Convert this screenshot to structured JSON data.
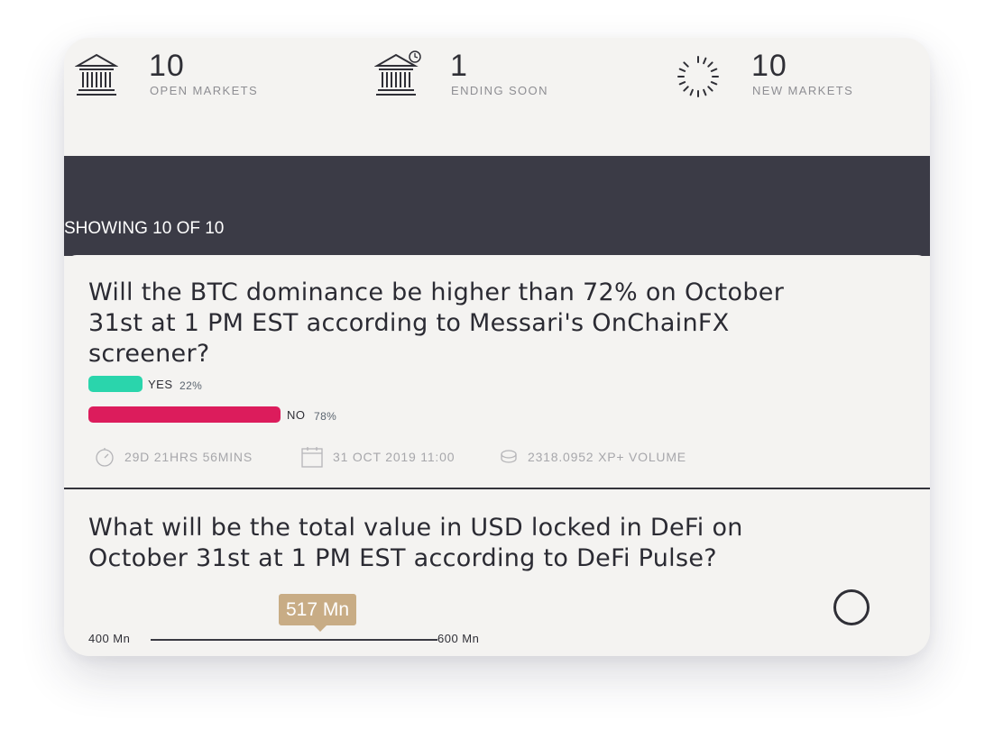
{
  "stats": [
    {
      "icon": "bank-icon",
      "value": "10",
      "label": "OPEN MARKETS"
    },
    {
      "icon": "bank-clock-icon",
      "value": "1",
      "label": "ENDING SOON"
    },
    {
      "icon": "spinner-icon",
      "value": "10",
      "label": "NEW MARKETS"
    }
  ],
  "showing": "SHOWING 10 OF 10",
  "markets": [
    {
      "title_lines": [
        "Will the BTC dominance be higher than 72% on October",
        "31st at 1 PM EST according to Messari's OnChainFX",
        "screener?"
      ],
      "options": [
        {
          "label": "YES",
          "percent_text": "22%",
          "fraction": 0.22,
          "color": "#2ad5ac"
        },
        {
          "label": "NO",
          "percent_text": "78%",
          "fraction": 0.78,
          "color": "#dc1c5c"
        }
      ],
      "time_left": "29D 21HRS 56MINS",
      "end_date": "31 OCT 2019 11:00",
      "volume": "2318.0952 XP+ VOLUME"
    },
    {
      "title_lines": [
        "What will be the total value in USD locked in DeFi on",
        "October 31st at 1 PM EST according to DeFi Pulse?"
      ],
      "slider": {
        "min_label": "400 Mn",
        "max_label": "600 Mn",
        "value_label": "517 Mn",
        "value": 517,
        "min": 400,
        "max": 600
      }
    }
  ],
  "colors": {
    "dark_band": "#3b3b46",
    "tooltip": "#c8ac85",
    "yes": "#2ad5ac",
    "no": "#dc1c5c"
  }
}
